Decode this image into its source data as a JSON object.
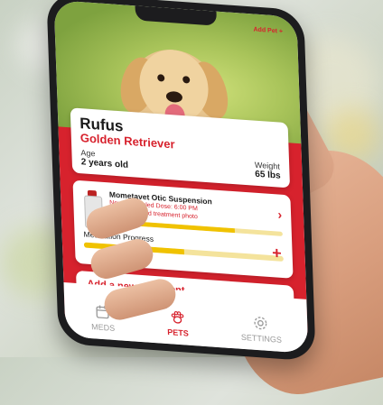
{
  "header": {
    "add_pet_label": "Add Pet +"
  },
  "pet": {
    "name": "Rufus",
    "breed": "Golden Retriever",
    "age_label": "Age",
    "age_value": "2 years old",
    "weight_label": "Weight",
    "weight_value": "65 lbs"
  },
  "treatment": {
    "name": "Mometavet Otic Suspension",
    "next_dose": "Next Scheduled Dose: 6:00 PM",
    "reminder": "Reminder: Add treatment photo",
    "progress_label": "Medication Progress",
    "progress_fraction": 0.72,
    "overall_fraction": 0.5
  },
  "actions": {
    "add_treatment_label": "Add a new treatment"
  },
  "nav": {
    "items": [
      {
        "label": "MEDS",
        "icon": "calendar-icon",
        "active": false
      },
      {
        "label": "PETS",
        "icon": "paw-icon",
        "active": true
      },
      {
        "label": "SETTINGS",
        "icon": "gear-icon",
        "active": false
      }
    ]
  },
  "colors": {
    "brand_red": "#d7222d",
    "progress_yellow": "#f0c200"
  }
}
